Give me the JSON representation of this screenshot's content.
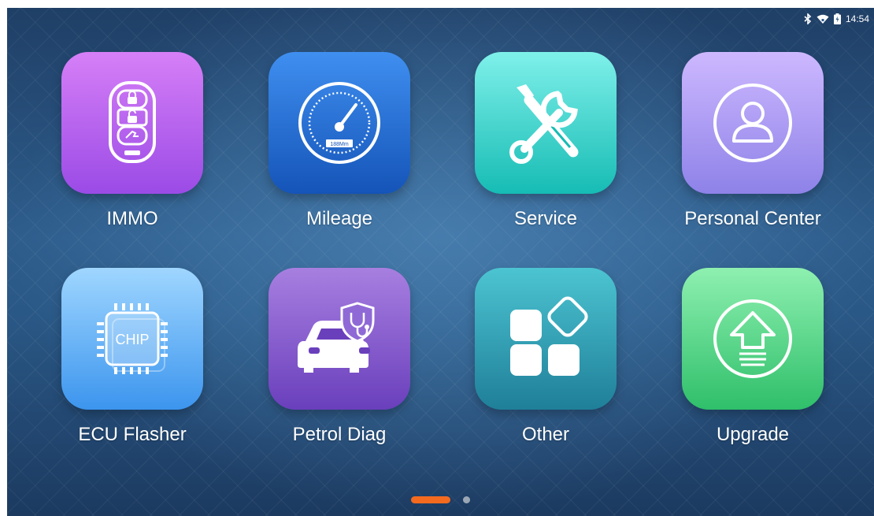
{
  "status": {
    "bluetooth_icon": "bluetooth-icon",
    "wifi_icon": "wifi-icon",
    "battery_icon": "battery-icon",
    "time": "14:54"
  },
  "apps": [
    {
      "label": "IMMO",
      "icon": "car-key-fob-icon",
      "gradient": [
        "#d67ff7",
        "#9b4be6"
      ]
    },
    {
      "label": "Mileage",
      "icon": "speedometer-icon",
      "gradient": [
        "#3f8ff0",
        "#1554b8"
      ]
    },
    {
      "label": "Service",
      "icon": "wrench-screwdriver-icon",
      "gradient": [
        "#7ff0ea",
        "#16bcb4"
      ]
    },
    {
      "label": "Personal Center",
      "icon": "user-profile-icon",
      "gradient": [
        "#cdb8ff",
        "#8e82e8"
      ]
    },
    {
      "label": "ECU Flasher",
      "icon": "chip-icon",
      "gradient": [
        "#9fd6ff",
        "#3c95ee"
      ]
    },
    {
      "label": "Petrol Diag",
      "icon": "car-diagnosis-icon",
      "gradient": [
        "#a77fe0",
        "#6a3fbc"
      ]
    },
    {
      "label": "Other",
      "icon": "app-grid-icon",
      "gradient": [
        "#4cc4d1",
        "#1f7f99"
      ]
    },
    {
      "label": "Upgrade",
      "icon": "upgrade-arrow-icon",
      "gradient": [
        "#8ef0b0",
        "#2fbf6a"
      ]
    }
  ],
  "speedometer_text": "188Mm",
  "chip_text": "CHIP",
  "pager": {
    "pages": 2,
    "current": 1
  }
}
